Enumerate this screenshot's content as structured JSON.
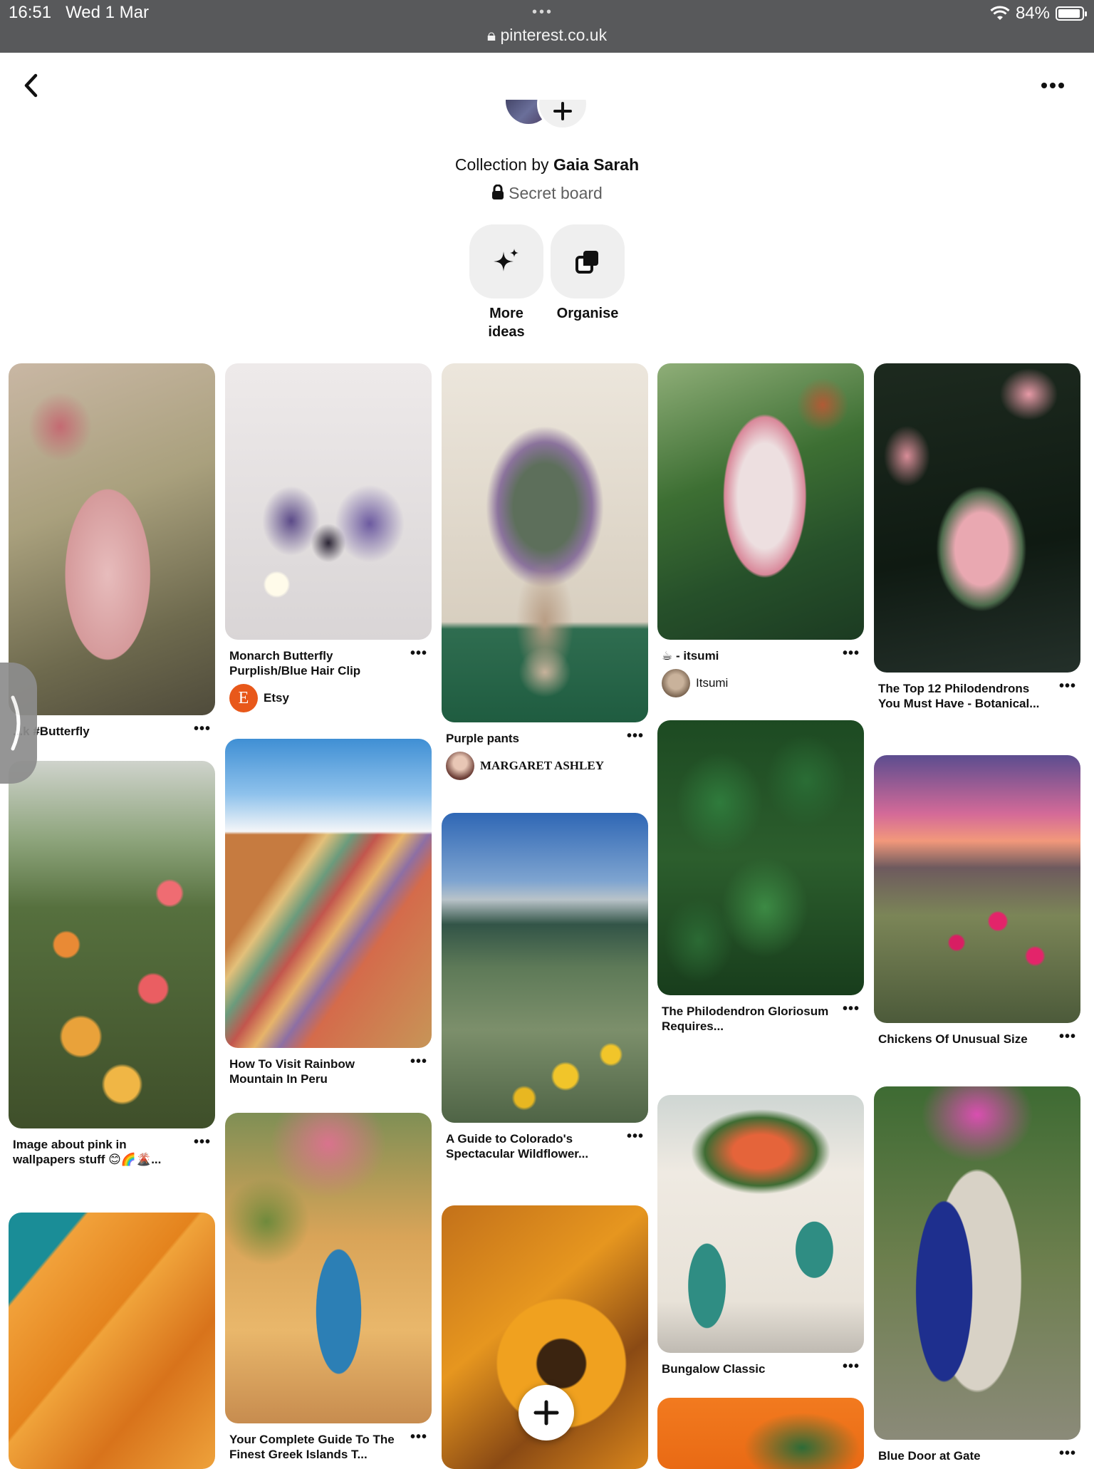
{
  "status_bar": {
    "time": "16:51",
    "date": "Wed 1 Mar",
    "url": "pinterest.co.uk",
    "battery": "84%",
    "battery_level": 0.84
  },
  "board": {
    "collection_prefix": "Collection by ",
    "owner": "Gaia Sarah",
    "privacy": "Secret board"
  },
  "actions": [
    {
      "label": "More ideas",
      "icon": "sparkle-icon"
    },
    {
      "label": "Organise",
      "icon": "organise-icon"
    }
  ],
  "pins": {
    "col1": [
      {
        "title": "...k #Butterfly"
      },
      {
        "title": "Image about pink in wallpapers stuff 😊🌈🌋..."
      },
      {
        "title": ""
      }
    ],
    "col2": [
      {
        "title": "Monarch Butterfly Purplish/Blue Hair Clip",
        "source": "Etsy"
      },
      {
        "title": "How To Visit Rainbow Mountain In Peru"
      },
      {
        "title": "Your Complete Guide To The Finest Greek Islands T..."
      }
    ],
    "col3": [
      {
        "title": "Purple pants",
        "source": "MARGARET ASHLEY"
      },
      {
        "title": "A Guide to Colorado's Spectacular Wildflower..."
      },
      {
        "title": ""
      }
    ],
    "col4": [
      {
        "title": "☕ - itsumi",
        "source": "Itsumi"
      },
      {
        "title": "The Philodendron Gloriosum Requires..."
      },
      {
        "title": "Bungalow Classic"
      },
      {
        "title": ""
      }
    ],
    "col5": [
      {
        "title": "The Top 12 Philodendrons You Must Have - Botanical..."
      },
      {
        "title": "Chickens Of Unusual Size"
      },
      {
        "title": "Blue Door at Gate"
      }
    ]
  },
  "colors": {
    "statusbar": "#58595b",
    "button_bg": "#efefef",
    "etsy": "#e8581a"
  }
}
